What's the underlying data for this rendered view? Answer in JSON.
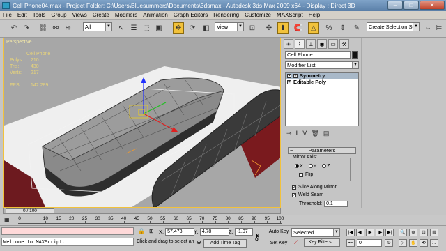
{
  "window": {
    "title": "Cell Phone04.max   - Project Folder: C:\\Users\\Bluesummers\\Documents\\3dsmax    - Autodesk 3ds Max  2009 x64    - Display : Direct 3D",
    "minimize": "–",
    "maximize": "□",
    "close": "✕"
  },
  "menu": [
    "File",
    "Edit",
    "Tools",
    "Group",
    "Views",
    "Create",
    "Modifiers",
    "Animation",
    "Graph Editors",
    "Rendering",
    "Customize",
    "MAXScript",
    "Help"
  ],
  "toolbar": {
    "selection_filter": "All",
    "ref_coord": "View",
    "named_selection": "Create Selection Se"
  },
  "viewport": {
    "label": "Perspective",
    "stats": {
      "object": "Cell Phone",
      "rows": [
        {
          "k": "Polys:",
          "v": "210"
        },
        {
          "k": "Tris:",
          "v": "430"
        },
        {
          "k": "Verts:",
          "v": "217"
        }
      ],
      "fps_label": "FPS:",
      "fps_value": "142.289"
    }
  },
  "command_panel": {
    "object_name": "Cell Phone",
    "modifier_list": "Modifier List",
    "stack": [
      {
        "label": "Symmetry",
        "selected": true
      },
      {
        "label": "Editable Poly",
        "selected": false
      }
    ],
    "rollout_title": "Parameters",
    "mirror_axis_label": "Mirror Axis:",
    "axes": [
      "X",
      "Y",
      "Z"
    ],
    "flip_label": "Flip",
    "slice_label": "Slice Along Mirror",
    "weld_label": "Weld Seam",
    "threshold_label": "Threshold:",
    "threshold_value": "0.1"
  },
  "timeline": {
    "frame_display": "0 / 100",
    "ticks": [
      "0",
      "10",
      "15",
      "20",
      "25",
      "30",
      "35",
      "40",
      "45",
      "50",
      "55",
      "60",
      "65",
      "70",
      "75",
      "80",
      "85",
      "90",
      "95",
      "100"
    ]
  },
  "status": {
    "listener_text": "Welcome to MAXScript.",
    "prompt": "Click and drag to select an",
    "x_label": "X:",
    "x_value": "57.473",
    "y_label": "Y:",
    "y_value": "4.78",
    "z_label": "Z:",
    "z_value": "-1.07",
    "add_time_tag": "Add Time Tag",
    "auto_key": "Auto Key",
    "selected": "Selected",
    "set_key": "Set Key",
    "key_filters": "Key Filters...",
    "frame_value": "0"
  }
}
